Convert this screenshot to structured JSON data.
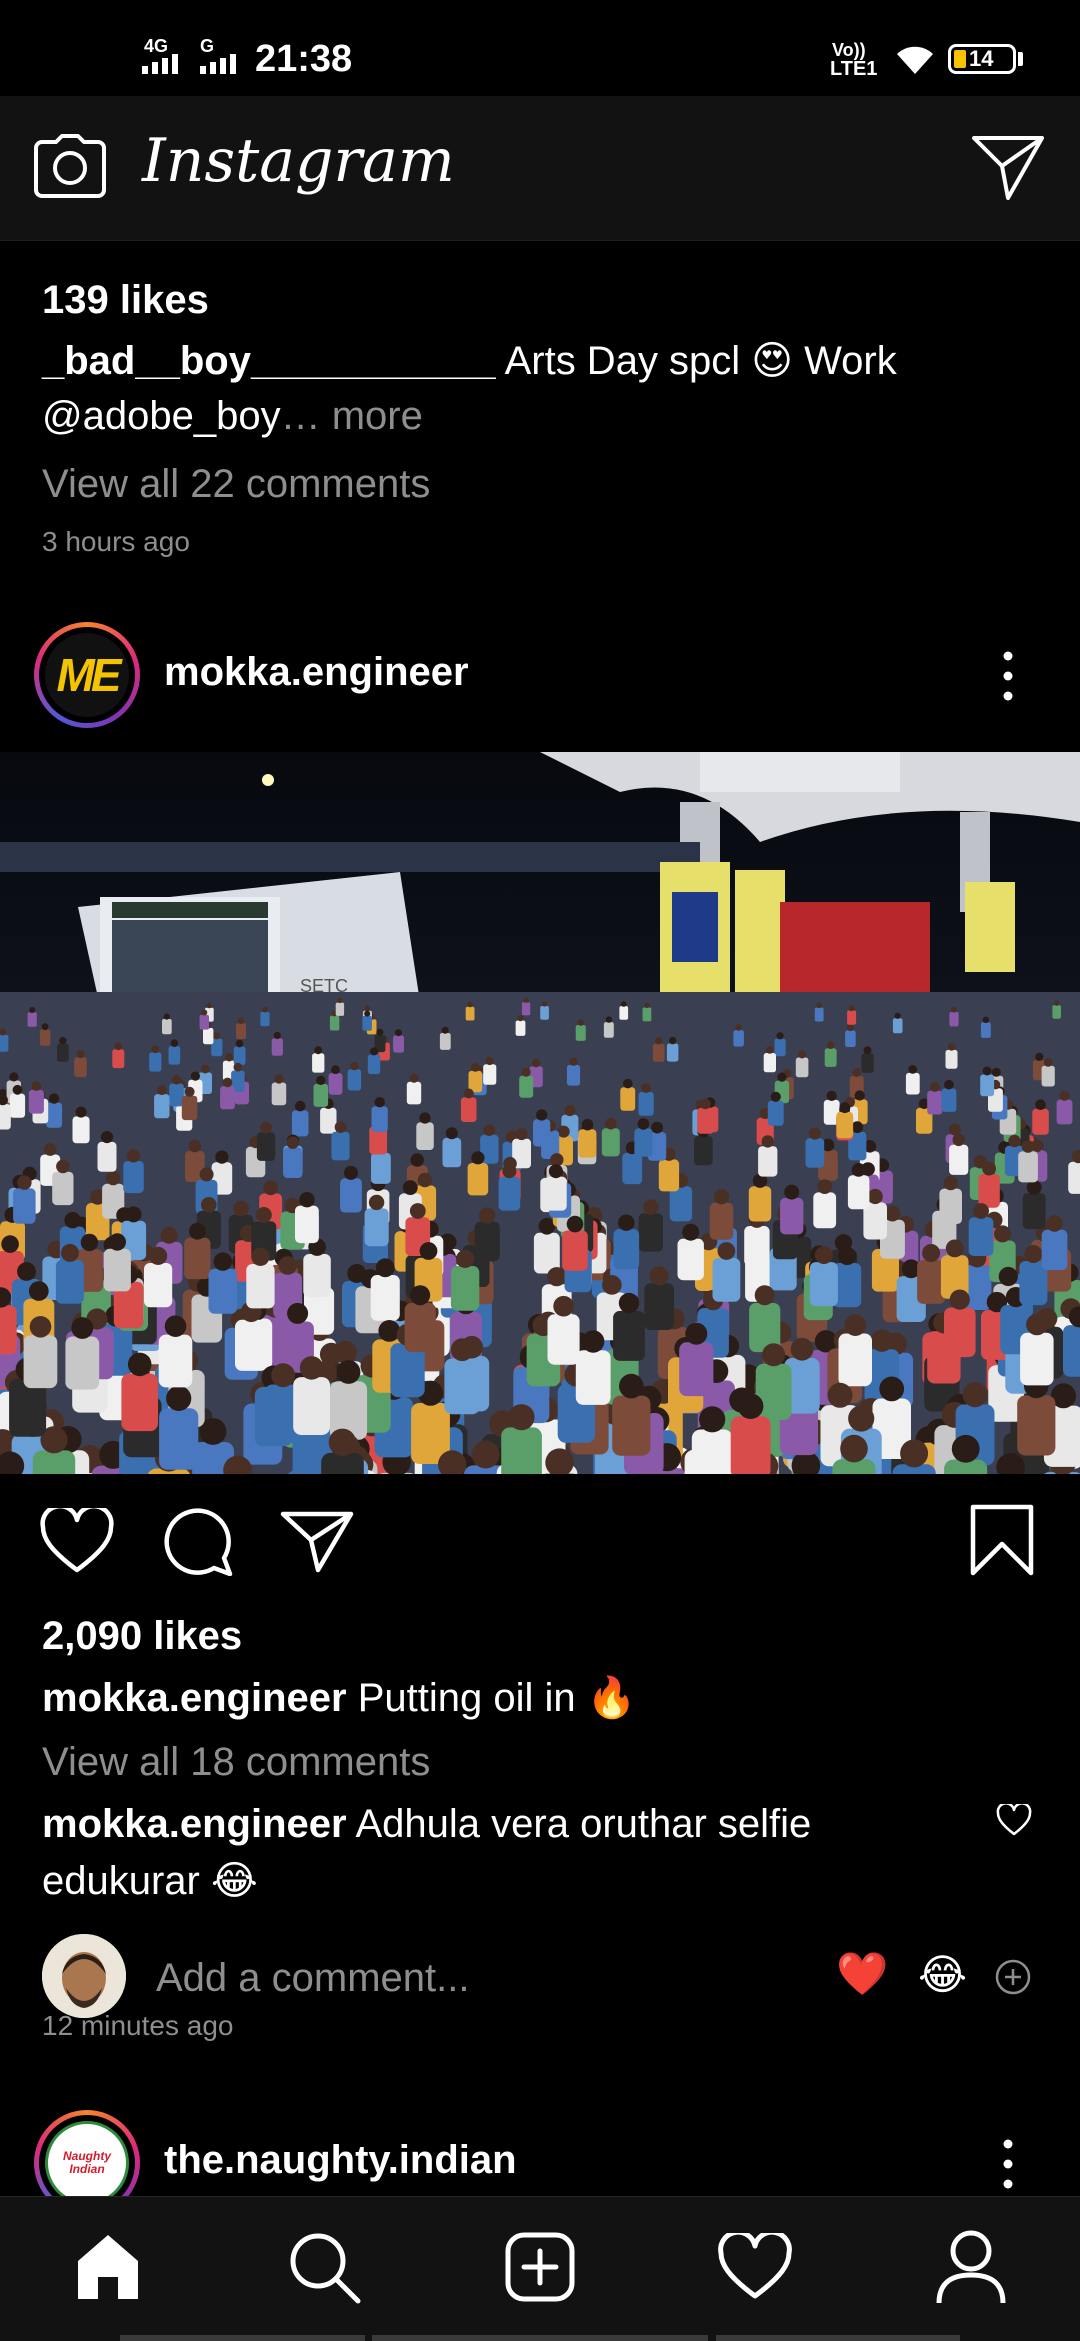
{
  "status_bar": {
    "network1": "4G",
    "network2": "G",
    "time": "21:38",
    "volte_top": "Vo))",
    "volte_bottom": "LTE1",
    "battery": "14"
  },
  "header": {
    "app_title": "Instagram",
    "camera_icon": "camera-icon",
    "dm_icon": "paper-plane-icon"
  },
  "prev_post": {
    "likes": "139 likes",
    "username": "_bad__boy___________",
    "caption": " Arts Day spcl 😍  Work",
    "caption_line2": "@adobe_boy",
    "more": "… more",
    "view_comments": "View all 22 comments",
    "time": "3 hours ago"
  },
  "post": {
    "username": "mokka.engineer",
    "avatar_text": "ME",
    "likes": "2,090 likes",
    "caption_user": "mokka.engineer",
    "caption_text": " Putting oil in 🔥",
    "view_comments": "View all 18 comments",
    "comment_user": "mokka.engineer",
    "comment_text": " Adhula vera oruthar selfie",
    "comment_text2": "edukurar 😂",
    "add_comment_placeholder": "Add a comment...",
    "quick_react1": "❤️",
    "quick_react2": "😂",
    "time": "12 minutes ago",
    "bus_sign": "SETC"
  },
  "next_post": {
    "username": "the.naughty.indian",
    "avatar_text": "Naughty Indian"
  },
  "bottom_nav": {
    "items": [
      "home-icon",
      "search-icon",
      "add-post-icon",
      "activity-heart-icon",
      "profile-icon"
    ]
  },
  "colors": {
    "background": "#000000",
    "bar": "#121212",
    "secondary_text": "#8e8e8e",
    "heart_red": "#ed1c24",
    "avatar_yellow": "#f5c400"
  }
}
